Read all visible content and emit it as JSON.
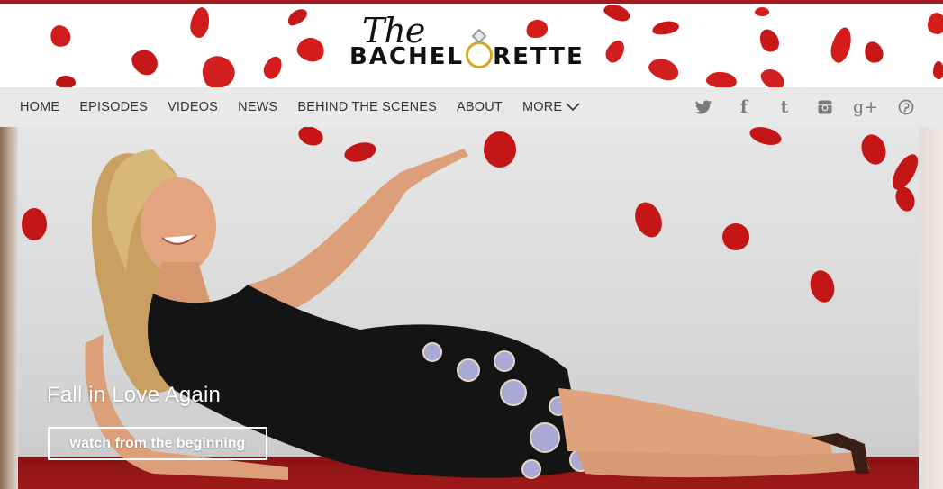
{
  "logo": {
    "the": "The",
    "word": "BACHELORETTE",
    "word_left": "BACHEL",
    "word_right": "RETTE"
  },
  "nav": {
    "items": [
      {
        "label": "HOME"
      },
      {
        "label": "EPISODES"
      },
      {
        "label": "VIDEOS"
      },
      {
        "label": "NEWS"
      },
      {
        "label": "BEHIND THE SCENES"
      },
      {
        "label": "ABOUT"
      },
      {
        "label": "MORE"
      }
    ]
  },
  "social": {
    "icons": [
      "twitter-icon",
      "facebook-icon",
      "tumblr-icon",
      "instagram-icon",
      "google-plus-icon",
      "pinterest-icon"
    ],
    "facebook_glyph": "f",
    "tumblr_glyph": "t",
    "gplus_glyph": "g+"
  },
  "hero": {
    "title": "Fall in Love Again",
    "cta_label": "watch from the beginning"
  },
  "colors": {
    "brand_red": "#a51a1e",
    "petal_red": "#d41c1c",
    "nav_bg": "#e9e9e9",
    "ring_gold": "#d8a320"
  }
}
